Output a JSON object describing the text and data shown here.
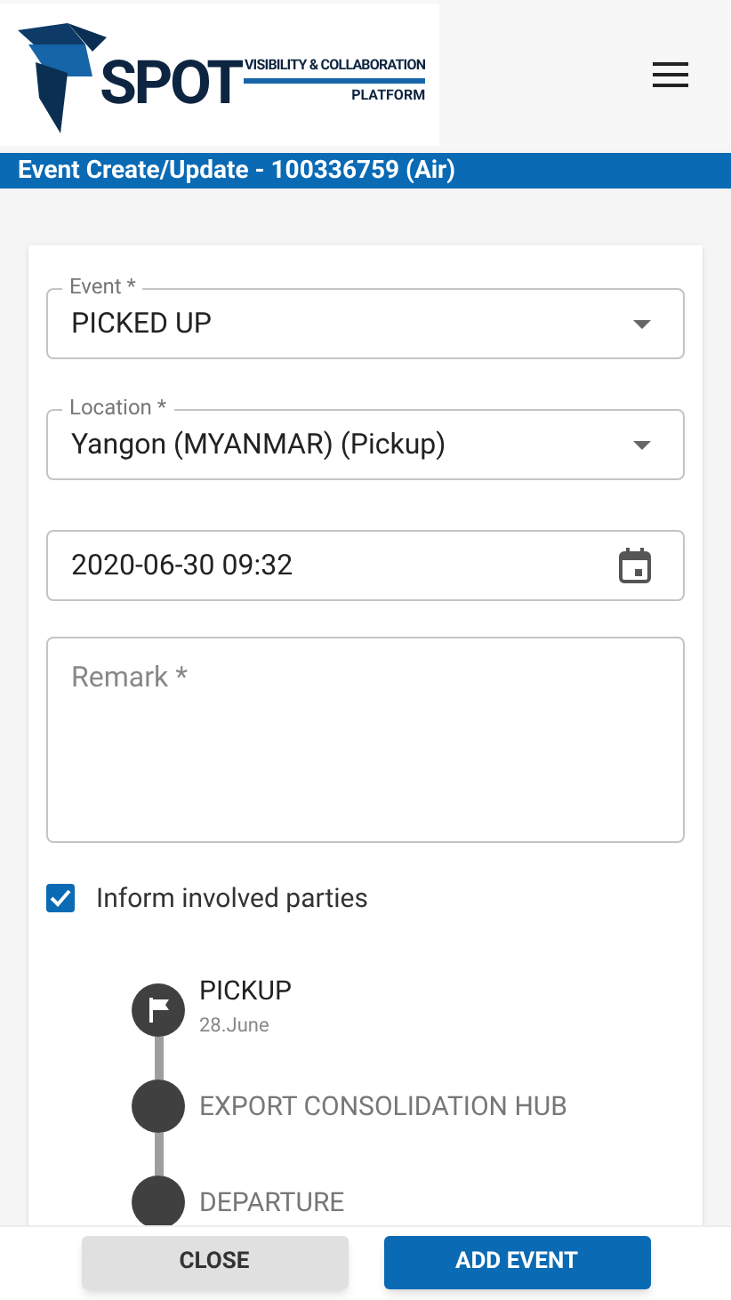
{
  "header": {
    "logo": {
      "wordmark": "SPOT",
      "tagline": "VISIBILITY & COLLABORATION",
      "subline": "PLATFORM"
    }
  },
  "title_bar": {
    "title": "Event Create/Update - 100336759 (Air)"
  },
  "fields": [
    {
      "kind": "select",
      "label": "Event *",
      "value": "PICKED UP"
    },
    {
      "kind": "select",
      "label": "Location *",
      "value": "Yangon (MYANMAR) (Pickup)"
    },
    {
      "kind": "date",
      "value": "2020-06-30 09:32"
    },
    {
      "kind": "textarea",
      "placeholder": "Remark *"
    }
  ],
  "inform": {
    "label": "Inform involved parties",
    "checked": true
  },
  "timeline": [
    {
      "label": "PICKUP",
      "date": "28.June",
      "done": true
    },
    {
      "label": "EXPORT CONSOLIDATION HUB",
      "done": false
    },
    {
      "label": "DEPARTURE",
      "done": false
    }
  ],
  "buttons": [
    {
      "kind": "secondary",
      "label": "CLOSE"
    },
    {
      "kind": "primary",
      "label": "ADD EVENT"
    }
  ]
}
